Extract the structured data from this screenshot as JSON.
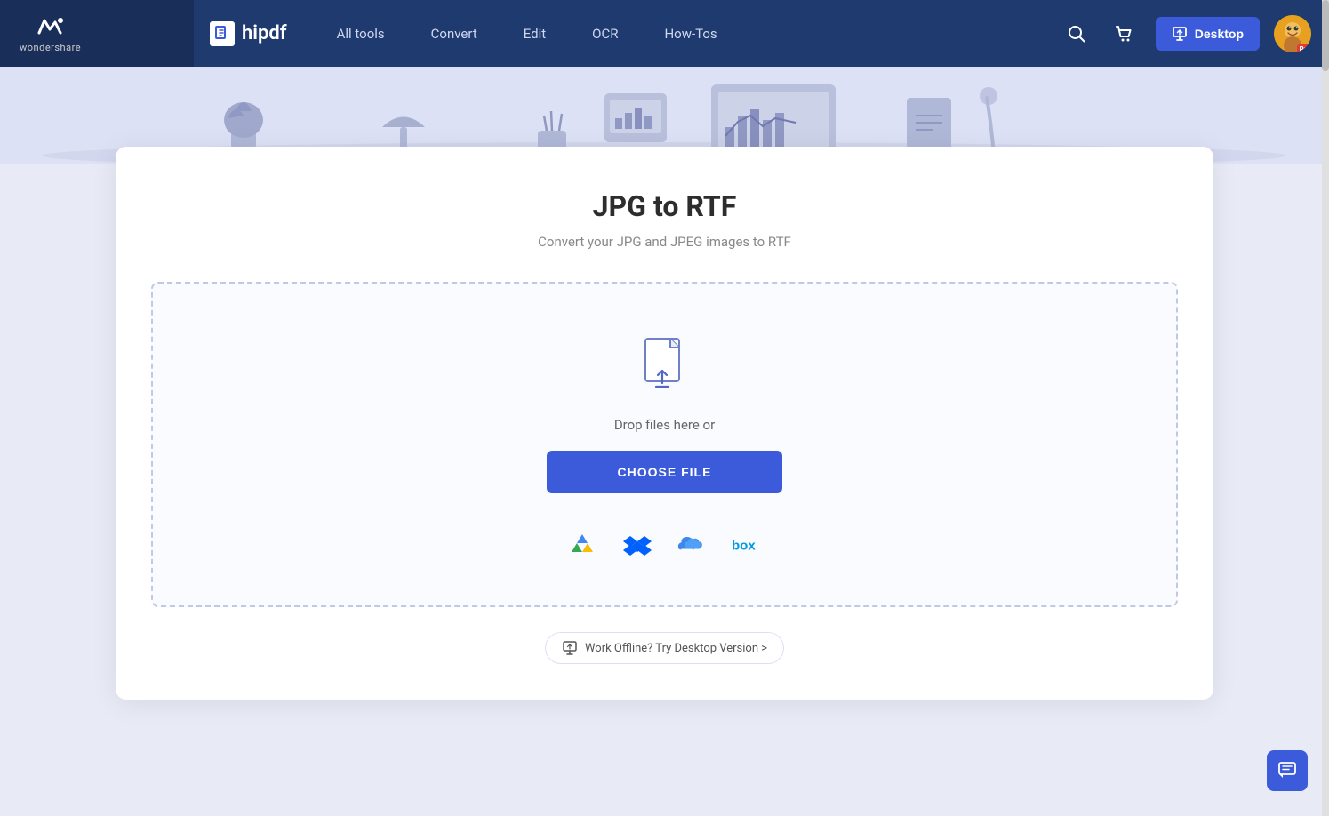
{
  "brand": {
    "wondershare": "wondershare",
    "hipdf": "hipdf"
  },
  "navbar": {
    "links": [
      {
        "id": "all-tools",
        "label": "All tools"
      },
      {
        "id": "convert",
        "label": "Convert"
      },
      {
        "id": "edit",
        "label": "Edit"
      },
      {
        "id": "ocr",
        "label": "OCR"
      },
      {
        "id": "how-tos",
        "label": "How-Tos"
      }
    ],
    "desktop_btn": "Desktop",
    "pro_badge": "Pro"
  },
  "converter": {
    "title": "JPG to RTF",
    "subtitle": "Convert your JPG and JPEG images to RTF",
    "drop_text": "Drop files here or",
    "choose_file_btn": "CHOOSE FILE",
    "offline_text": "Work Offline? Try Desktop Version >"
  },
  "cloud_services": [
    {
      "id": "google-drive",
      "label": "Google Drive"
    },
    {
      "id": "dropbox",
      "label": "Dropbox"
    },
    {
      "id": "onedrive",
      "label": "OneDrive"
    },
    {
      "id": "box",
      "label": "Box"
    }
  ],
  "colors": {
    "accent": "#3b5bdb",
    "navbar_bg": "#1e3a6e",
    "page_bg": "#e8eaf6"
  }
}
